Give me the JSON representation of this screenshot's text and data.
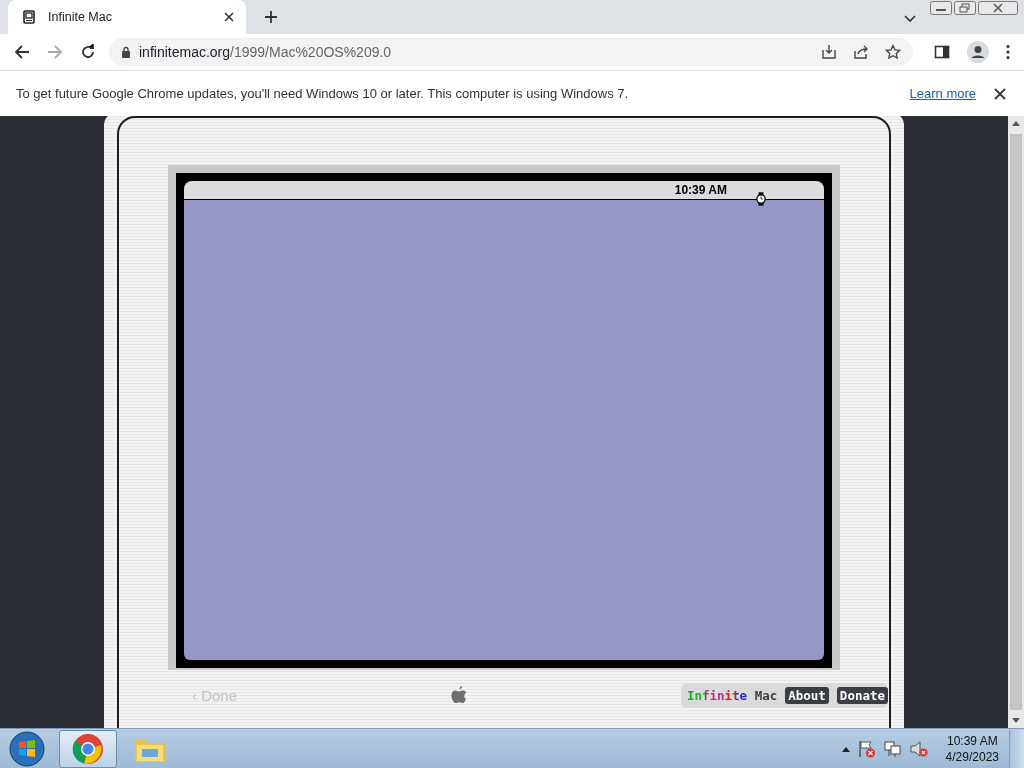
{
  "browser": {
    "tabs": [
      {
        "title": "Infinite Mac",
        "selected": true
      }
    ],
    "address": "infinitemac.org/1999/Mac%20OS%209.0",
    "infobar": {
      "message": "To get future Google Chrome updates, you'll need Windows 10 or later. This computer is using Windows 7.",
      "link": "Learn more"
    }
  },
  "emulator": {
    "menubar_clock": "10:39 AM",
    "done": "‹ Done",
    "brand": "Infinite Mac",
    "links": [
      "About",
      "Donate"
    ]
  },
  "taskbar": {
    "time": "10:39 AM",
    "date": "4/29/2023"
  }
}
